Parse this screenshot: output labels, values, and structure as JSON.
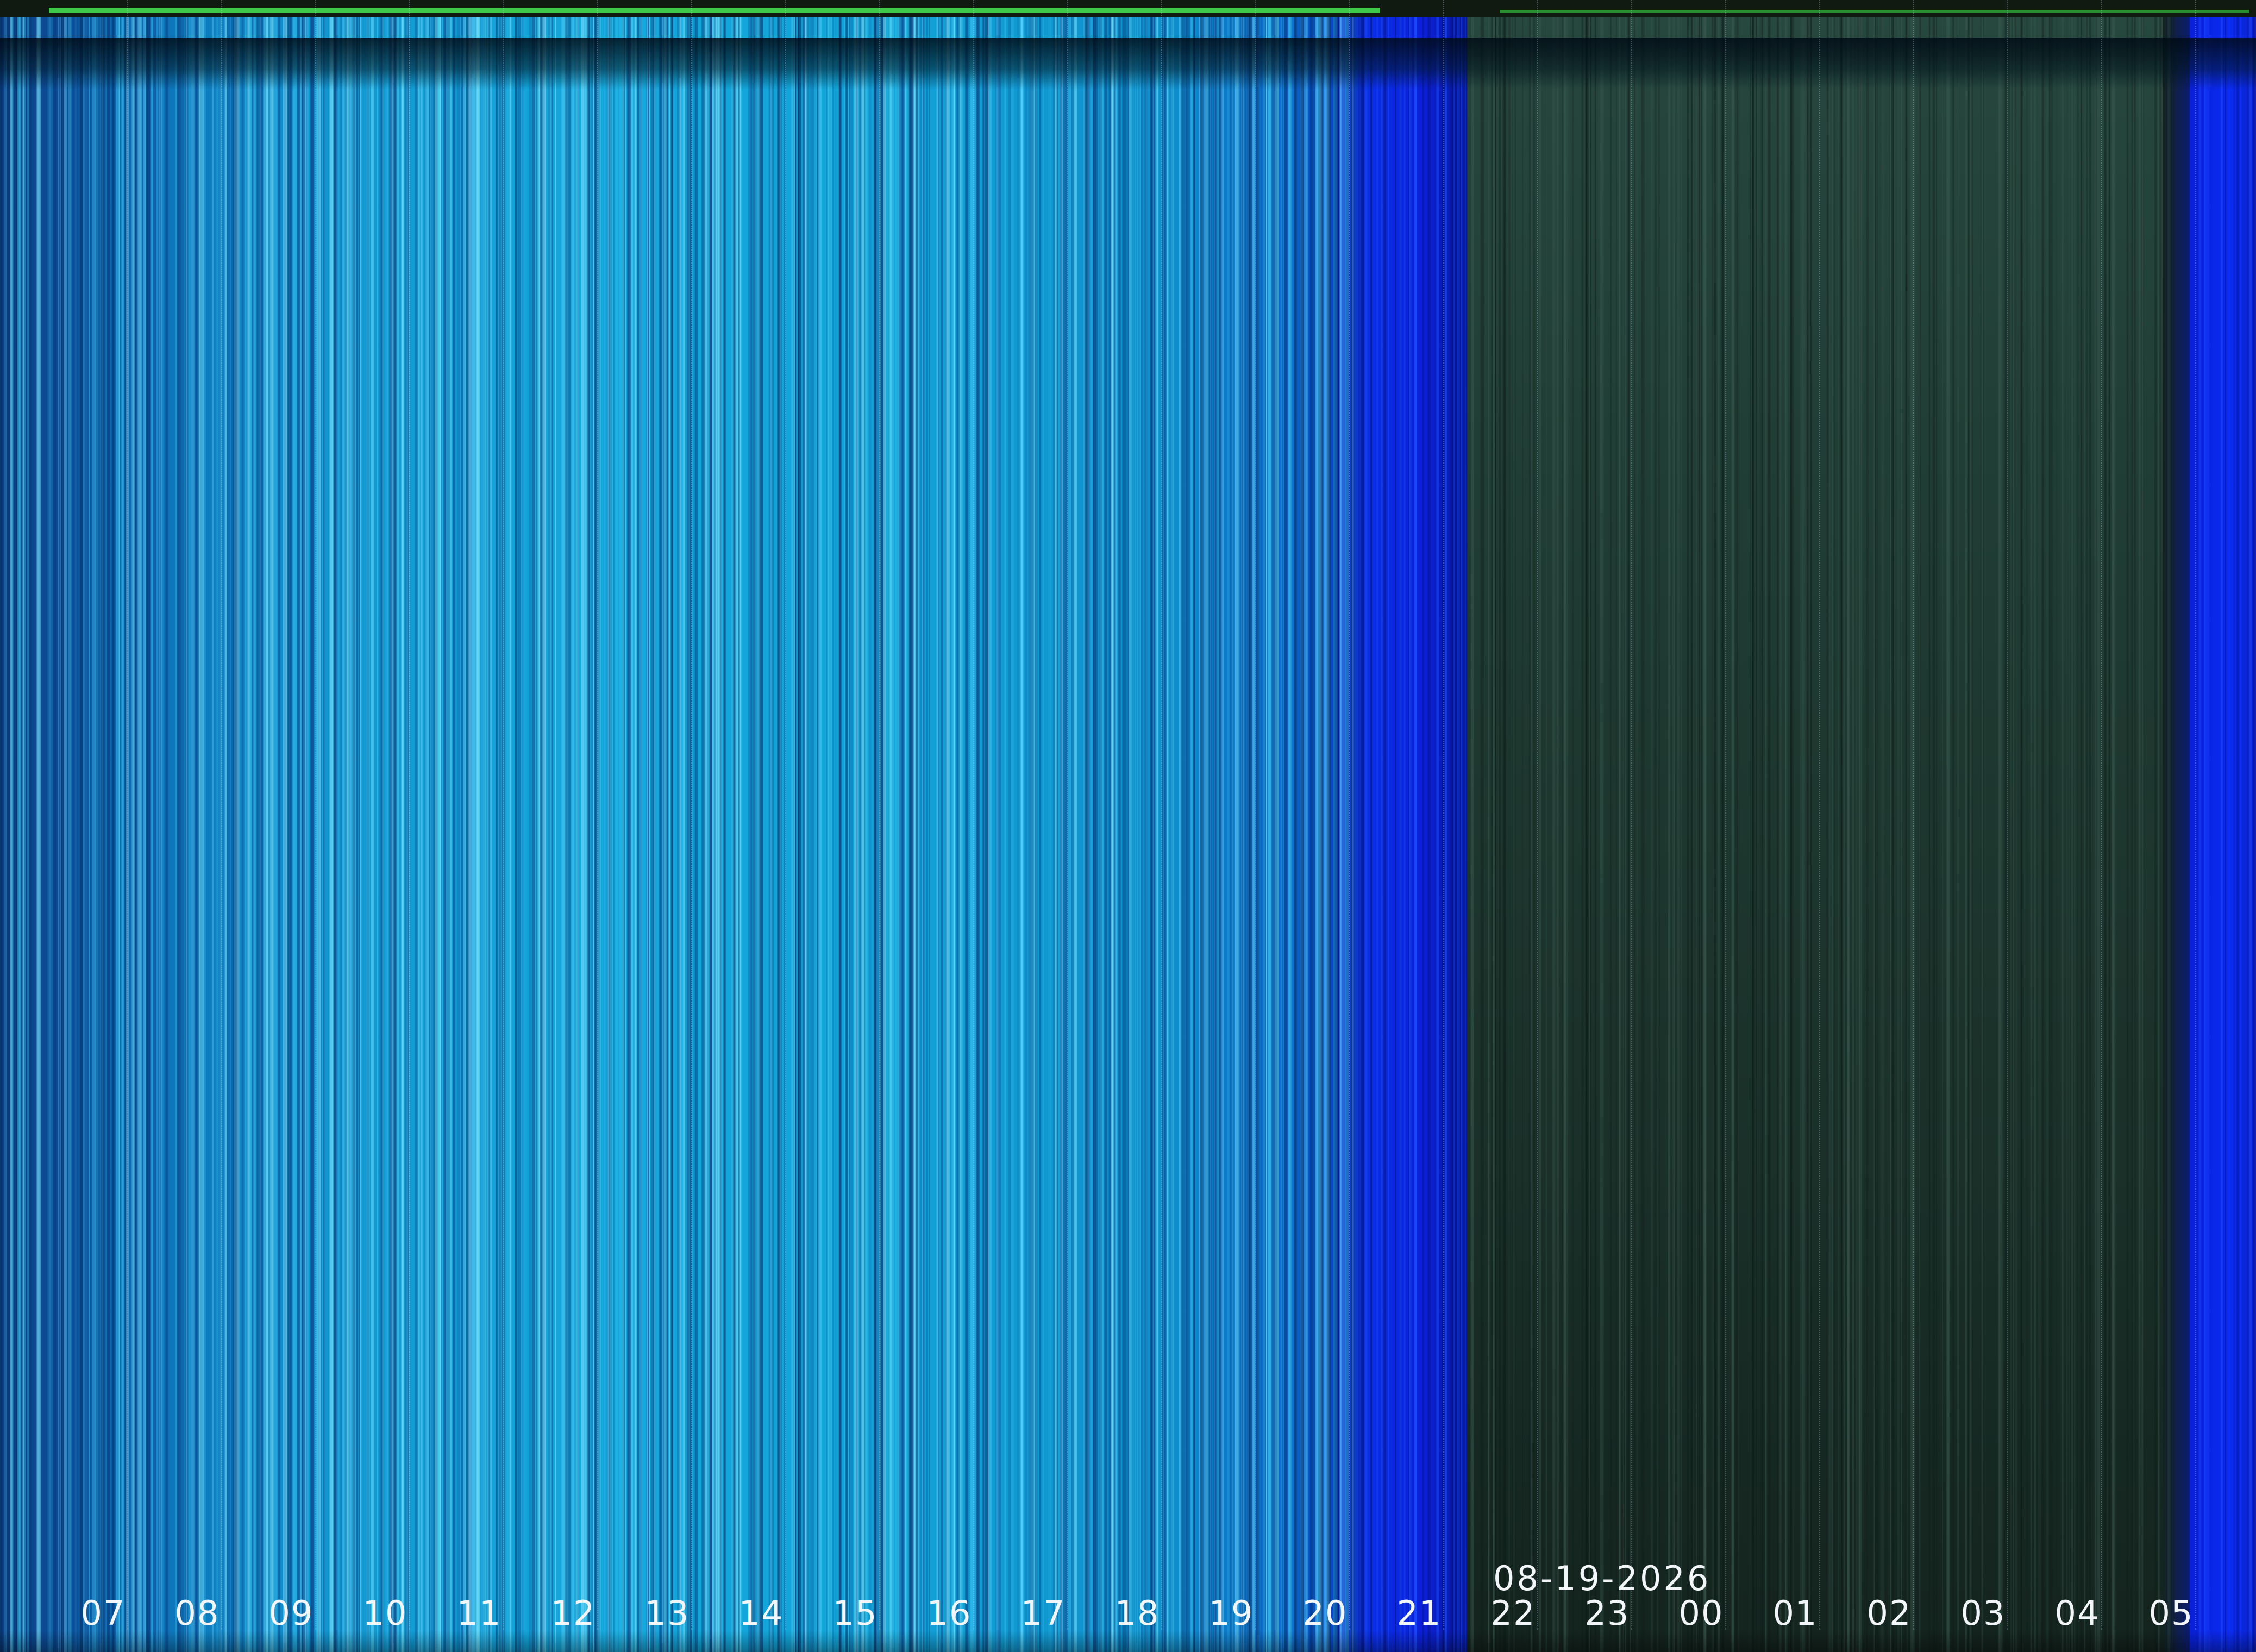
{
  "date_label": "08-19-2026",
  "hour_labels": [
    "07",
    "08",
    "09",
    "10",
    "11",
    "12",
    "13",
    "14",
    "15",
    "16",
    "17",
    "18",
    "19",
    "20",
    "21",
    "22",
    "23",
    "00",
    "01",
    "02",
    "03",
    "04",
    "05"
  ],
  "colors": {
    "day_sky": "#14a8dc",
    "dusk_blue": "#0b2cf2",
    "night": "#1f3b33",
    "status_bar": "#3fc94a",
    "label_text": "#f2f6f8"
  }
}
